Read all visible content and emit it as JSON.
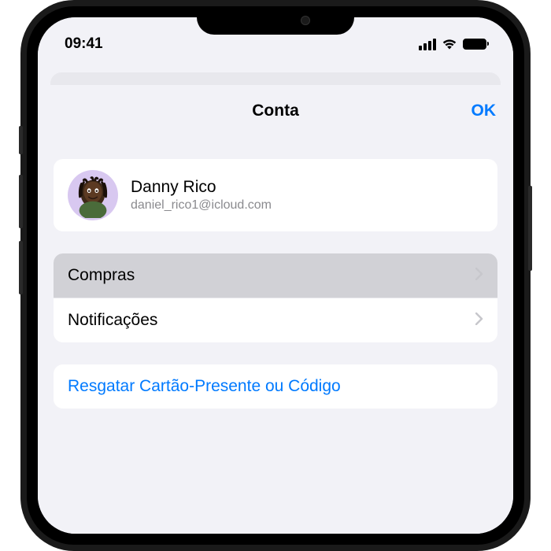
{
  "statusBar": {
    "time": "09:41"
  },
  "modal": {
    "title": "Conta",
    "okButton": "OK"
  },
  "profile": {
    "name": "Danny Rico",
    "email": "daniel_rico1@icloud.com"
  },
  "menuItems": {
    "purchases": "Compras",
    "notifications": "Notificações"
  },
  "links": {
    "redeemGiftCard": "Resgatar Cartão-Presente ou Código"
  }
}
